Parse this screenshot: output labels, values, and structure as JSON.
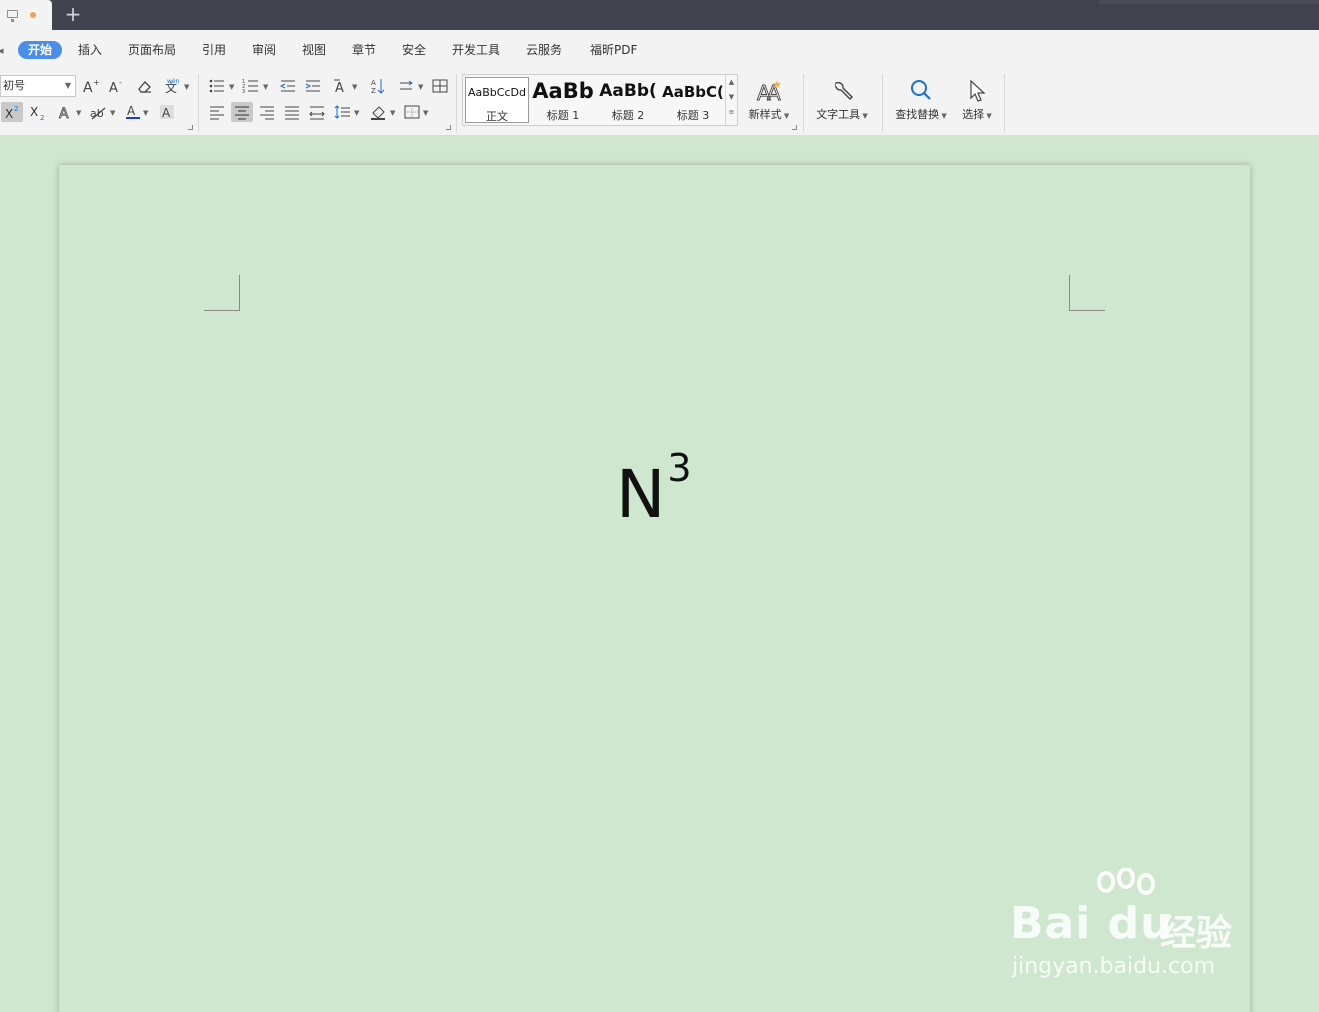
{
  "titlebar": {
    "new_tab_symbol": "+"
  },
  "menu": {
    "items": [
      "开始",
      "插入",
      "页面布局",
      "引用",
      "审阅",
      "视图",
      "章节",
      "安全",
      "开发工具",
      "云服务",
      "福昕PDF"
    ],
    "active": "开始"
  },
  "ribbon": {
    "font_size_value": "初号",
    "style_gallery": [
      {
        "preview": "AaBbCcDd",
        "label": "正文"
      },
      {
        "preview": "AaBb",
        "label": "标题 1"
      },
      {
        "preview": "AaBb(",
        "label": "标题 2"
      },
      {
        "preview": "AaBbC(",
        "label": "标题 3"
      }
    ],
    "new_style_label": "新样式",
    "text_tools_label": "文字工具",
    "find_replace_label": "查找替换",
    "select_label": "选择"
  },
  "document": {
    "base_text": "N",
    "superscript_text": "3"
  },
  "watermark": {
    "brand": "Bai du",
    "brand_cn": "经验",
    "url": "jingyan.baidu.com"
  },
  "colors": {
    "page_background": "#cfe7ce",
    "titlebar": "#41434f",
    "active_tab": "#4a8eea",
    "font_color_underline": "#1a3fd0"
  }
}
